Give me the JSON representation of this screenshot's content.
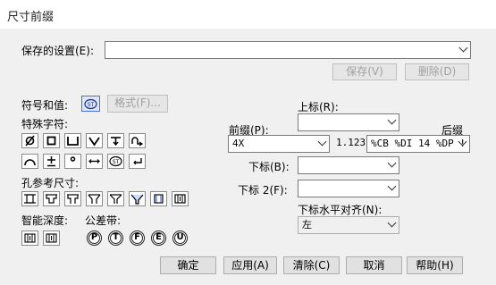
{
  "window": {
    "title": "尺寸前缀"
  },
  "saved_settings": {
    "label": "保存的设置(E):",
    "value": "",
    "save_button": "保存(V)",
    "delete_button": "删除(D)"
  },
  "symbols_values": {
    "label": "符号和值:",
    "format_button": "格式(F)..."
  },
  "special_chars": {
    "label": "特殊字符:",
    "glyphs_row1": [
      "⌀",
      "□",
      "⊔",
      "∨",
      "⊤",
      "⤐"
    ],
    "glyphs_row2": [
      "⌒",
      "±",
      "°",
      "↔",
      "ST",
      "⮌"
    ]
  },
  "hole_dims": {
    "label": "孔参考尺寸:"
  },
  "smart_depth": {
    "label": "智能深度:"
  },
  "tolerance_band": {
    "label": "公差带:",
    "letters": [
      "P",
      "T",
      "F",
      "E",
      "U"
    ]
  },
  "superscript": {
    "label": "上标(R):",
    "value": ""
  },
  "prefix": {
    "label": "前缀(P):",
    "value": "4X"
  },
  "value_display": "1.123",
  "suffix": {
    "label": "后缀",
    "value": "%CB %DI 14 %DP !"
  },
  "subscript": {
    "label": "下标(B):",
    "value": ""
  },
  "subscript2": {
    "label": "下标 2(F):",
    "value": ""
  },
  "subscript_align": {
    "label": "下标水平对齐(N):",
    "value": "左"
  },
  "footer": {
    "ok": "确定",
    "apply": "应用(A)",
    "clear": "清除(C)",
    "cancel": "取消",
    "help": "帮助(H)"
  }
}
